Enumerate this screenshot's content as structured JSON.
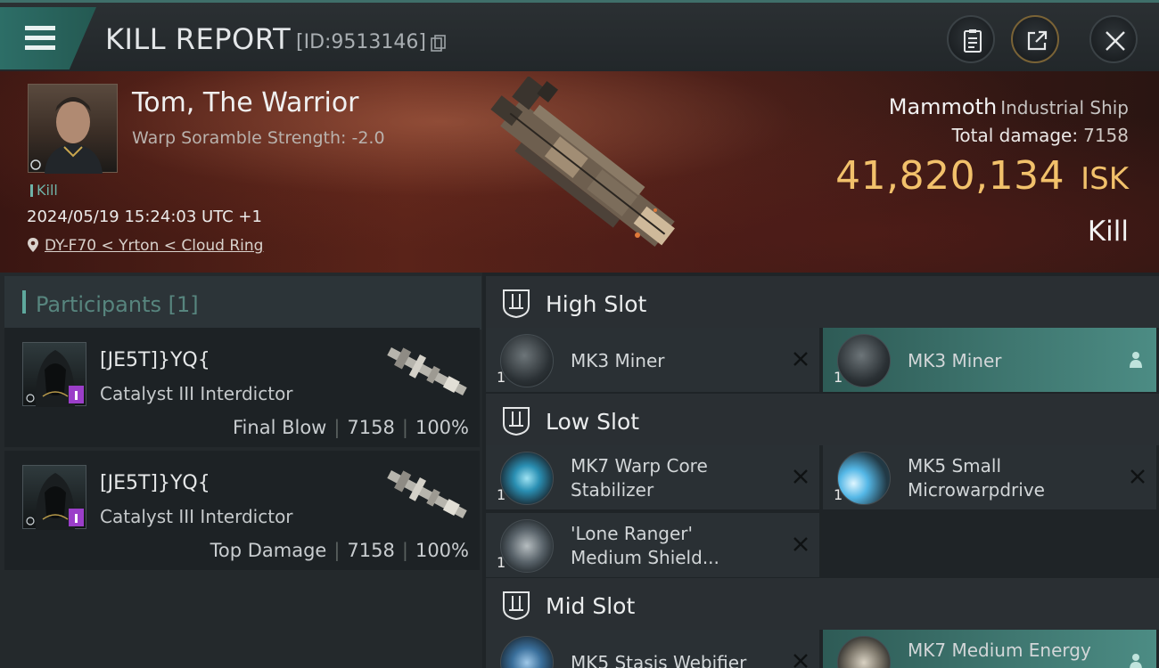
{
  "header": {
    "title": "KILL REPORT",
    "report_id": "[ID:9513146]"
  },
  "victim": {
    "pilot_name": "Tom, The Warrior",
    "warp_scramble": "Warp Soramble Strength: -2.0",
    "tag": "Kill",
    "datetime": "2024/05/19 15:24:03 UTC +1",
    "location": "DY-F70 < Yrton < Cloud Ring",
    "ship_name": "Mammoth",
    "ship_class": "Industrial Ship",
    "total_damage_label": "Total damage:",
    "total_damage": "7158",
    "isk_value": "41,820,134",
    "isk_unit": "ISK",
    "result": "Kill"
  },
  "participants": {
    "label": "Participants [1]",
    "list": [
      {
        "name": "[JE5T]}YQ{",
        "ship": "Catalyst III Interdictor",
        "role": "Final Blow",
        "damage": "7158",
        "percent": "100%"
      },
      {
        "name": "[JE5T]}YQ{",
        "ship": "Catalyst III Interdictor",
        "role": "Top Damage",
        "damage": "7158",
        "percent": "100%"
      }
    ]
  },
  "slots": {
    "high": {
      "label": "High Slot",
      "modules": [
        {
          "name": "MK3 Miner",
          "count": "1"
        },
        {
          "name": "MK3 Miner",
          "count": "1"
        }
      ]
    },
    "low": {
      "label": "Low Slot",
      "modules": [
        {
          "name_line1": "MK7 Warp Core",
          "name_line2": "Stabilizer",
          "count": "1"
        },
        {
          "name_line1": "MK5 Small",
          "name_line2": "Microwarpdrive",
          "count": "1"
        },
        {
          "name_line1": "'Lone Ranger'",
          "name_line2": "Medium Shield...",
          "count": "1"
        }
      ]
    },
    "mid": {
      "label": "Mid Slot",
      "modules": [
        {
          "name": "MK5 Stasis Webifier"
        },
        {
          "name": "MK7 Medium Energy"
        }
      ]
    }
  },
  "colors": {
    "accent_teal": "#2d6e67",
    "isk_gold": "#f2c16b",
    "highlight_module": "#4c8c84"
  }
}
